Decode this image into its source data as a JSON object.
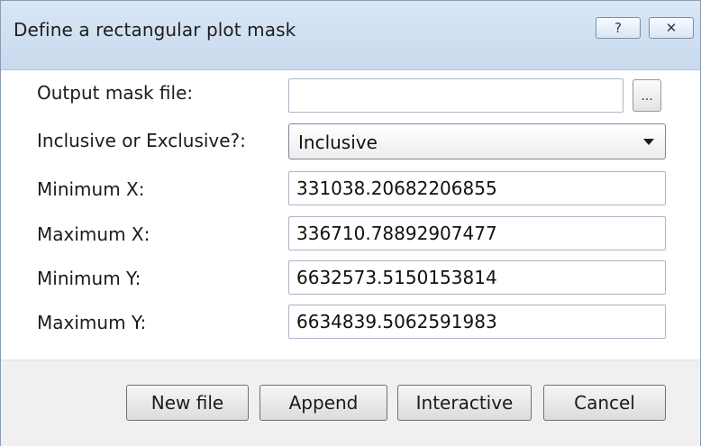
{
  "window": {
    "title": "Define a rectangular plot mask",
    "help_glyph": "?",
    "close_glyph": "✕"
  },
  "form": {
    "output_mask_file": {
      "label": "Output mask file:",
      "value": "",
      "browse_label": "..."
    },
    "inclusive": {
      "label": "Inclusive or Exclusive?:",
      "selected": "Inclusive"
    },
    "min_x": {
      "label": "Minimum X:",
      "value": "331038.20682206855"
    },
    "max_x": {
      "label": "Maximum X:",
      "value": "336710.78892907477"
    },
    "min_y": {
      "label": "Minimum Y:",
      "value": "6632573.5150153814"
    },
    "max_y": {
      "label": "Maximum Y:",
      "value": "6634839.5062591983"
    }
  },
  "buttons": {
    "new_file": "New file",
    "append": "Append",
    "interactive": "Interactive",
    "cancel": "Cancel"
  }
}
